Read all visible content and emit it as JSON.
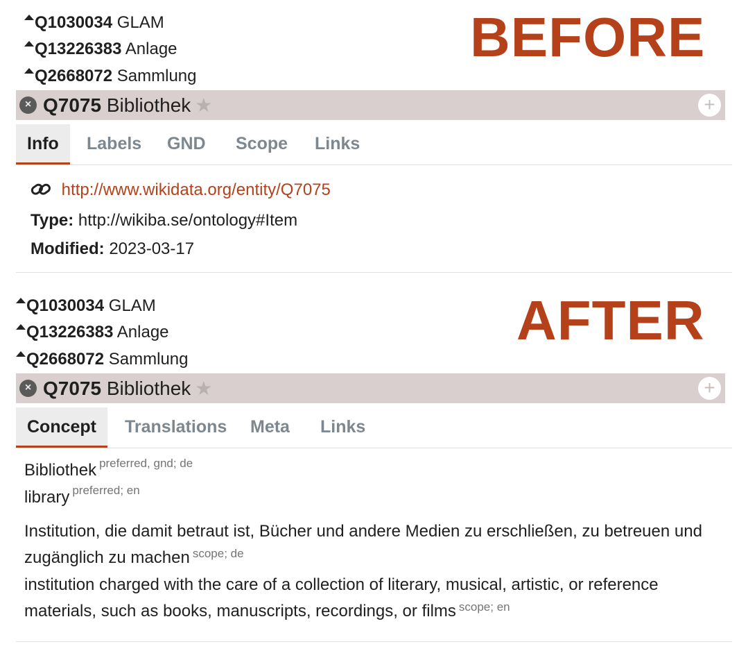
{
  "before": {
    "stamp": "BEFORE",
    "ancestors": [
      {
        "qid": "Q1030034",
        "label": "GLAM"
      },
      {
        "qid": "Q13226383",
        "label": "Anlage"
      },
      {
        "qid": "Q2668072",
        "label": "Sammlung"
      }
    ],
    "entity": {
      "qid": "Q7075",
      "label": "Bibliothek"
    },
    "tabs": [
      "Info",
      "Labels",
      "GND",
      "Scope",
      "Links"
    ],
    "active_tab": "Info",
    "info": {
      "uri": "http://www.wikidata.org/entity/Q7075",
      "type_label": "Type:",
      "type_value": "http://wikiba.se/ontology#Item",
      "modified_label": "Modified:",
      "modified_value": "2023-03-17"
    }
  },
  "after": {
    "stamp": "AFTER",
    "ancestors": [
      {
        "qid": "Q1030034",
        "label": "GLAM"
      },
      {
        "qid": "Q13226383",
        "label": "Anlage"
      },
      {
        "qid": "Q2668072",
        "label": "Sammlung"
      }
    ],
    "entity": {
      "qid": "Q7075",
      "label": "Bibliothek"
    },
    "tabs": [
      "Concept",
      "Translations",
      "Meta",
      "Links"
    ],
    "active_tab": "Concept",
    "terms": [
      {
        "text": "Bibliothek",
        "meta": "preferred, gnd; de"
      },
      {
        "text": "library",
        "meta": "preferred; en"
      }
    ],
    "scopes": [
      {
        "text": "Institution, die damit betraut ist, Bücher und andere Medien zu erschließen, zu betreuen und zugänglich zu machen",
        "meta": "scope; de"
      },
      {
        "text": "institution charged with the care of a collection of literary, musical, artistic, or reference materials, such as books, manuscripts, recordings, or films",
        "meta": "scope; en"
      }
    ]
  },
  "icons": {
    "close": "close-icon",
    "star": "star-icon",
    "plus": "plus-icon",
    "link": "link-icon",
    "broader": "broader-arrow-icon"
  },
  "colors": {
    "accent": "#b5411b",
    "header_bg": "#dacfcf",
    "muted_tab": "#7d8790"
  }
}
